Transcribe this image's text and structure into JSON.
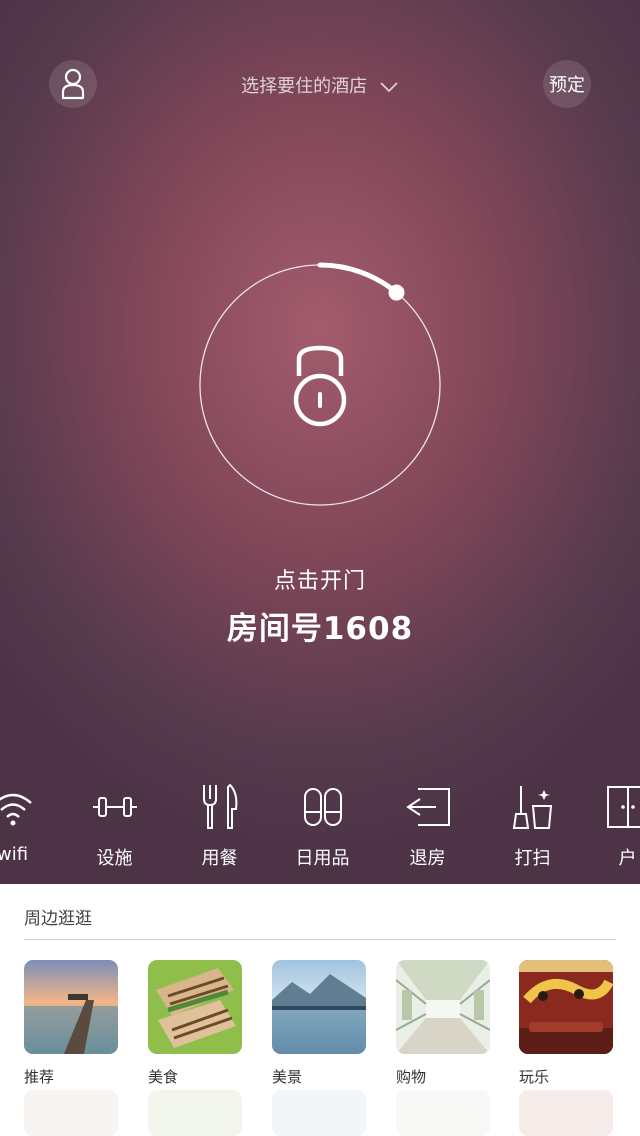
{
  "header": {
    "hotel_select": "选择要住的酒店",
    "book_label": "预定"
  },
  "lock": {
    "action_label": "点击开门",
    "room_label": "房间号1608",
    "progress": 0.11
  },
  "services": [
    {
      "label": "wifi",
      "icon": "wifi-icon"
    },
    {
      "label": "设施",
      "icon": "dumbbell-icon"
    },
    {
      "label": "用餐",
      "icon": "fork-knife-icon"
    },
    {
      "label": "日用品",
      "icon": "slippers-icon"
    },
    {
      "label": "退房",
      "icon": "checkout-icon"
    },
    {
      "label": "打扫",
      "icon": "broom-icon"
    },
    {
      "label": "户",
      "icon": "window-icon"
    }
  ],
  "nearby": {
    "title": "周边逛逛",
    "items": [
      {
        "label": "推荐",
        "icon": "pier-photo"
      },
      {
        "label": "美食",
        "icon": "food-photo"
      },
      {
        "label": "美景",
        "icon": "lake-photo"
      },
      {
        "label": "购物",
        "icon": "mall-photo"
      },
      {
        "label": "玩乐",
        "icon": "bar-photo"
      }
    ]
  }
}
